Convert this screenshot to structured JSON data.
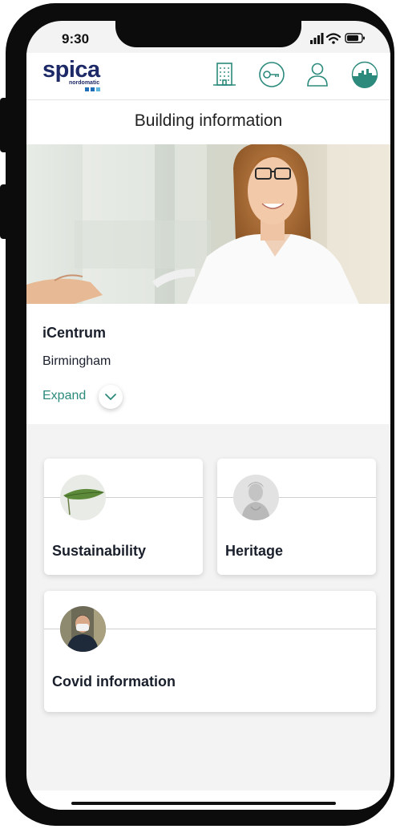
{
  "status": {
    "time": "9:30"
  },
  "header": {
    "logo_main": "spica",
    "logo_sub": "nordomatic",
    "icons": [
      "building-icon",
      "key-icon",
      "user-icon",
      "skyline-icon"
    ],
    "accent_color": "#2b8a7b",
    "brand_color": "#1e2a68"
  },
  "page": {
    "title": "Building information"
  },
  "building": {
    "name": "iCentrum",
    "city": "Birmingham",
    "expand_label": "Expand"
  },
  "cards": [
    {
      "label": "Sustainability",
      "icon": "leaf-icon"
    },
    {
      "label": "Heritage",
      "icon": "statue-icon"
    },
    {
      "label": "Covid information",
      "icon": "masked-person-icon"
    }
  ]
}
